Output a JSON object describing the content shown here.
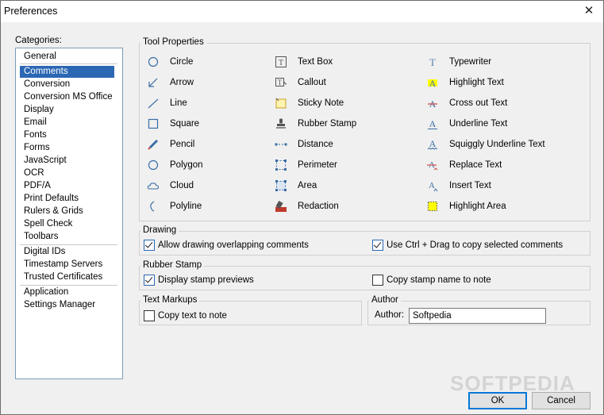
{
  "window": {
    "title": "Preferences"
  },
  "categories": {
    "label": "Categories:",
    "items": [
      {
        "label": "General"
      },
      {
        "label": "Comments",
        "selected": true
      },
      {
        "label": "Conversion"
      },
      {
        "label": "Conversion MS Office"
      },
      {
        "label": "Display"
      },
      {
        "label": "Email"
      },
      {
        "label": "Fonts"
      },
      {
        "label": "Forms"
      },
      {
        "label": "JavaScript"
      },
      {
        "label": "OCR"
      },
      {
        "label": "PDF/A"
      },
      {
        "label": "Print Defaults"
      },
      {
        "label": "Rulers & Grids"
      },
      {
        "label": "Spell Check"
      },
      {
        "label": "Toolbars"
      },
      {
        "label": "Digital IDs"
      },
      {
        "label": "Timestamp Servers"
      },
      {
        "label": "Trusted Certificates"
      },
      {
        "label": "Application"
      },
      {
        "label": "Settings Manager"
      }
    ]
  },
  "tool_properties": {
    "title": "Tool Properties",
    "col1": [
      {
        "label": "Circle",
        "icon": "circle-icon"
      },
      {
        "label": "Arrow",
        "icon": "arrow-icon"
      },
      {
        "label": "Line",
        "icon": "line-icon"
      },
      {
        "label": "Square",
        "icon": "square-icon"
      },
      {
        "label": "Pencil",
        "icon": "pencil-icon"
      },
      {
        "label": "Polygon",
        "icon": "polygon-icon"
      },
      {
        "label": "Cloud",
        "icon": "cloud-icon"
      },
      {
        "label": "Polyline",
        "icon": "polyline-icon"
      }
    ],
    "col2": [
      {
        "label": "Text Box",
        "icon": "text-box-icon"
      },
      {
        "label": "Callout",
        "icon": "callout-icon"
      },
      {
        "label": "Sticky Note",
        "icon": "sticky-note-icon"
      },
      {
        "label": "Rubber Stamp",
        "icon": "rubber-stamp-icon"
      },
      {
        "label": "Distance",
        "icon": "distance-icon"
      },
      {
        "label": "Perimeter",
        "icon": "perimeter-icon"
      },
      {
        "label": "Area",
        "icon": "area-icon"
      },
      {
        "label": "Redaction",
        "icon": "redaction-icon"
      }
    ],
    "col3": [
      {
        "label": "Typewriter",
        "icon": "typewriter-icon"
      },
      {
        "label": "Highlight Text",
        "icon": "highlight-text-icon"
      },
      {
        "label": "Cross out Text",
        "icon": "cross-out-text-icon"
      },
      {
        "label": "Underline Text",
        "icon": "underline-text-icon"
      },
      {
        "label": "Squiggly Underline Text",
        "icon": "squiggly-underline-icon"
      },
      {
        "label": "Replace Text",
        "icon": "replace-text-icon"
      },
      {
        "label": "Insert Text",
        "icon": "insert-text-icon"
      },
      {
        "label": "Highlight Area",
        "icon": "highlight-area-icon"
      }
    ]
  },
  "drawing": {
    "title": "Drawing",
    "allow_overlap": {
      "label": "Allow drawing overlapping comments",
      "checked": true
    },
    "ctrl_drag": {
      "label": "Use Ctrl + Drag to copy selected comments",
      "checked": true
    }
  },
  "rubber_stamp": {
    "title": "Rubber Stamp",
    "display_previews": {
      "label": "Display stamp previews",
      "checked": true
    },
    "copy_name": {
      "label": "Copy stamp name to note",
      "checked": false
    }
  },
  "text_markups": {
    "title": "Text Markups",
    "copy_text": {
      "label": "Copy text to note",
      "checked": false
    }
  },
  "author": {
    "title": "Author",
    "label": "Author:",
    "value": "Softpedia"
  },
  "buttons": {
    "ok": "OK",
    "cancel": "Cancel"
  },
  "watermark": "SOFTPEDIA",
  "colors": {
    "selection": "#2b67b3",
    "highlight": "#ffff00",
    "icon_blue": "#3a6ea5"
  }
}
